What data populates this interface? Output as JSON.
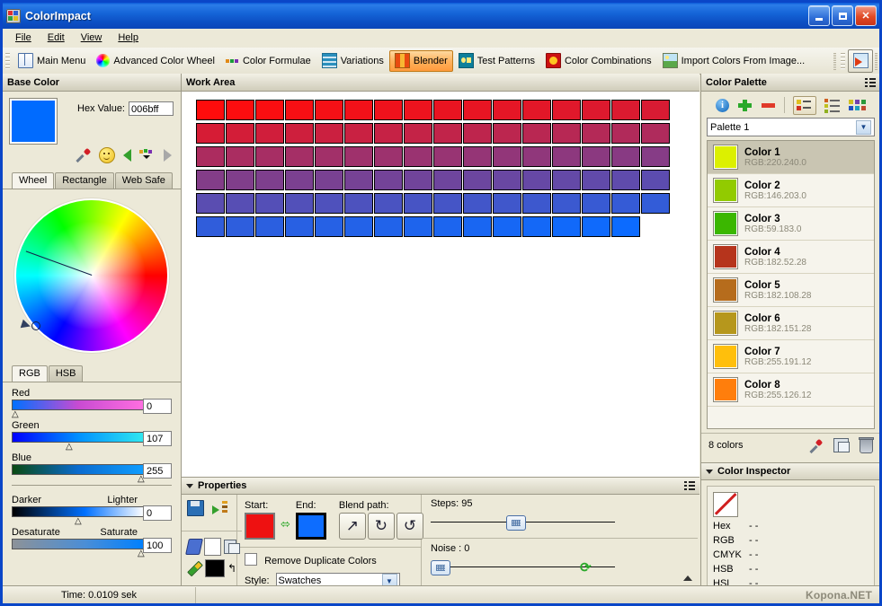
{
  "window": {
    "title": "ColorImpact",
    "icon": "app-icon",
    "minimize": "Minimize",
    "maximize": "Maximize",
    "close": "Close"
  },
  "menubar": {
    "items": [
      "File",
      "Edit",
      "View",
      "Help"
    ]
  },
  "toolbar": {
    "items": [
      {
        "label": "Main Menu",
        "icon": "book-icon",
        "active": false
      },
      {
        "label": "Advanced Color Wheel",
        "icon": "color-wheel-icon",
        "active": false
      },
      {
        "label": "Color Formulae",
        "icon": "formulae-icon",
        "active": false
      },
      {
        "label": "Variations",
        "icon": "variations-icon",
        "active": false
      },
      {
        "label": "Blender",
        "icon": "blender-icon",
        "active": true
      },
      {
        "label": "Test Patterns",
        "icon": "test-patterns-icon",
        "active": false
      },
      {
        "label": "Color Combinations",
        "icon": "color-combinations-icon",
        "active": false
      },
      {
        "label": "Import Colors From Image...",
        "icon": "import-image-icon",
        "active": false
      }
    ],
    "export_button_icon": "export-image-icon"
  },
  "base_color": {
    "title": "Base Color",
    "hex_label": "Hex Value:",
    "hex_value": "006bff",
    "swatch_color": "#006bff",
    "icons": [
      "eyedropper-icon",
      "smiley-icon",
      "arrow-left-icon",
      "palette-dropdown-icon",
      "arrow-right-icon"
    ],
    "picker_tabs": [
      "Wheel",
      "Rectangle",
      "Web Safe"
    ],
    "picker_tab_selected": "Wheel",
    "model_tabs": [
      "RGB",
      "HSB"
    ],
    "model_tab_selected": "RGB",
    "channels": [
      {
        "label": "Red",
        "value": "0",
        "pos_pct": 0
      },
      {
        "label": "Green",
        "value": "107",
        "pos_pct": 42
      },
      {
        "label": "Blue",
        "value": "255",
        "pos_pct": 96
      }
    ],
    "adjusters": [
      {
        "left_label": "Darker",
        "right_label": "Lighter",
        "value": "0",
        "pos_pct": 49
      },
      {
        "left_label": "Desaturate",
        "right_label": "Saturate",
        "value": "100",
        "pos_pct": 96
      }
    ]
  },
  "work_area": {
    "title": "Work Area",
    "columns": 16,
    "swatch_count": 95,
    "start_color": "#ff0c0c",
    "end_color": "#0c6bff"
  },
  "properties": {
    "title": "Properties",
    "save_icon": "save-icon",
    "export_palette_icon": "export-to-palette-icon",
    "fill_icon": "fill-bucket-icon",
    "fill_color": "#ffffff",
    "pen_icon": "pencil-icon",
    "pen_color": "#000000",
    "swap_fill_icon": "swap-colors-icon",
    "copy_color_icon": "copy-color-icon",
    "start_label": "Start:",
    "end_label": "End:",
    "start_color": "#ee1111",
    "end_color": "#0d6dff",
    "swap_icon": "swap-arrow-icon",
    "blend_path_label": "Blend path:",
    "blend_paths": [
      "direct-arrow-icon",
      "clockwise-icon",
      "counter-clockwise-icon"
    ],
    "blend_path_selected": "direct-arrow-icon",
    "remove_duplicates_label": "Remove Duplicate Colors",
    "remove_duplicates_checked": false,
    "style_label": "Style:",
    "style_value": "Swatches",
    "steps_label": "Steps: 95",
    "steps_pos_pct": 41,
    "noise_label": "Noise : 0",
    "noise_pos_pct": 0,
    "refresh_icon": "refresh-icon",
    "collapse_icon": "collapse-icon"
  },
  "palette": {
    "title": "Color Palette",
    "tools": [
      "info-icon",
      "add-icon",
      "remove-icon",
      "detail-view-icon",
      "list-view-icon",
      "grid-view-icon"
    ],
    "selected_view": "detail-view-icon",
    "selector_value": "Palette 1",
    "items": [
      {
        "name": "Color 1",
        "rgb": "RGB:220.240.0",
        "color": "#dcf000",
        "selected": true
      },
      {
        "name": "Color 2",
        "rgb": "RGB:146.203.0",
        "color": "#92cb00",
        "selected": false
      },
      {
        "name": "Color 3",
        "rgb": "RGB:59.183.0",
        "color": "#3bb700",
        "selected": false
      },
      {
        "name": "Color 4",
        "rgb": "RGB:182.52.28",
        "color": "#b6341c",
        "selected": false
      },
      {
        "name": "Color 5",
        "rgb": "RGB:182.108.28",
        "color": "#b66c1c",
        "selected": false
      },
      {
        "name": "Color 6",
        "rgb": "RGB:182.151.28",
        "color": "#b6971c",
        "selected": false
      },
      {
        "name": "Color 7",
        "rgb": "RGB:255.191.12",
        "color": "#ffbf0c",
        "selected": false
      },
      {
        "name": "Color 8",
        "rgb": "RGB:255.126.12",
        "color": "#ff7e0c",
        "selected": false
      }
    ],
    "count_label": "8 colors",
    "footer_tools": [
      "eyedropper-icon",
      "copy-swatch-icon",
      "trash-icon"
    ]
  },
  "inspector": {
    "title": "Color Inspector",
    "swatch": "no-color-icon",
    "rows": [
      {
        "key": "Hex",
        "value": "- -"
      },
      {
        "key": "RGB",
        "value": "- -"
      },
      {
        "key": "CMYK",
        "value": "- -"
      },
      {
        "key": "HSB",
        "value": "- -"
      },
      {
        "key": "HSL",
        "value": "- -"
      }
    ]
  },
  "statusbar": {
    "time": "Time: 0.0109 sek",
    "right": ""
  },
  "watermark": "Kopona.NET"
}
